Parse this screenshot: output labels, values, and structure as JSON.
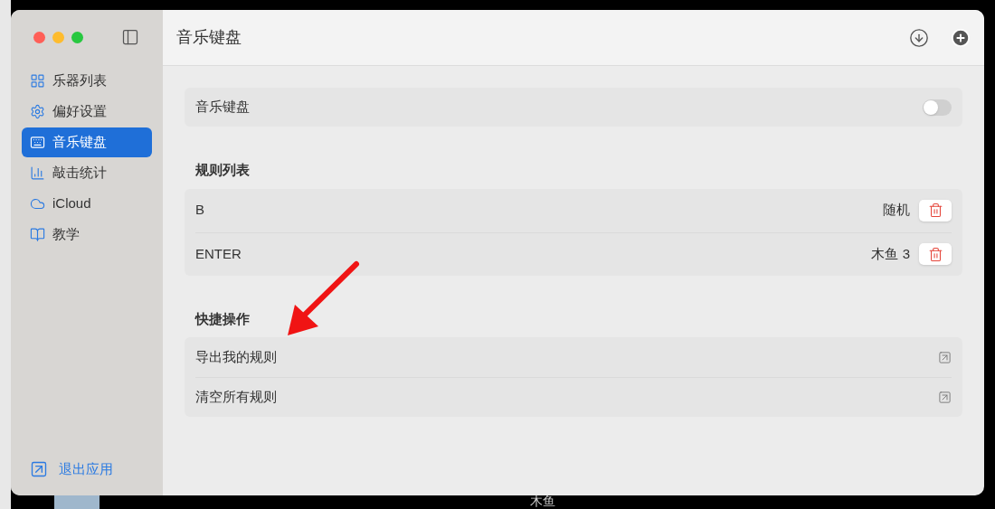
{
  "window": {
    "title": "音乐键盘"
  },
  "sidebar": {
    "items": [
      {
        "kind": "grid",
        "label": "乐器列表",
        "selected": false
      },
      {
        "kind": "gear",
        "label": "偏好设置",
        "selected": false
      },
      {
        "kind": "keyboard",
        "label": "音乐键盘",
        "selected": true
      },
      {
        "kind": "bars",
        "label": "敲击统计",
        "selected": false
      },
      {
        "kind": "cloud",
        "label": "iCloud",
        "selected": false
      },
      {
        "kind": "book",
        "label": "教学",
        "selected": false
      }
    ],
    "footer": "退出应用"
  },
  "toggle_row": {
    "label": "音乐键盘",
    "on": false
  },
  "rules": {
    "heading": "规则列表",
    "rows": [
      {
        "key": "B",
        "sound": "随机"
      },
      {
        "key": "ENTER",
        "sound": "木鱼 3"
      }
    ]
  },
  "actions": {
    "heading": "快捷操作",
    "items": [
      {
        "label": "导出我的规则"
      },
      {
        "label": "清空所有规则"
      }
    ]
  },
  "background_text": "木鱼"
}
